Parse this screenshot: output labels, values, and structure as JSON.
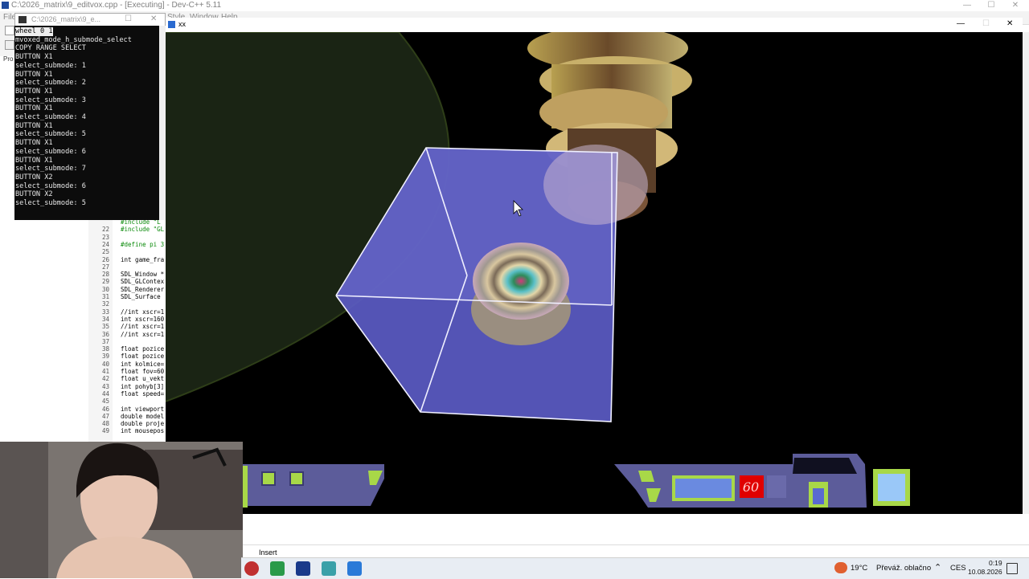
{
  "devcpp": {
    "window_title": "C:\\2026_matrix\\9_editvox.cpp - [Executing] - Dev-C++ 5.11",
    "menu": [
      "File",
      "Style",
      "Window",
      "Help"
    ],
    "sidebar_tab": "Pro",
    "editor_lines": [
      {
        "n": "",
        "t": "#include \"L",
        "c": "green"
      },
      {
        "n": "22",
        "t": "#include \"GL",
        "c": "green"
      },
      {
        "n": "23",
        "t": "",
        "c": ""
      },
      {
        "n": "24",
        "t": "#define pi 3",
        "c": "green"
      },
      {
        "n": "25",
        "t": "",
        "c": ""
      },
      {
        "n": "26",
        "t": "int game_fra",
        "c": ""
      },
      {
        "n": "27",
        "t": "",
        "c": ""
      },
      {
        "n": "28",
        "t": "SDL_Window *",
        "c": ""
      },
      {
        "n": "29",
        "t": "SDL_GLContex",
        "c": ""
      },
      {
        "n": "30",
        "t": "SDL_Renderer",
        "c": ""
      },
      {
        "n": "31",
        "t": "SDL_Surface",
        "c": ""
      },
      {
        "n": "32",
        "t": "",
        "c": ""
      },
      {
        "n": "33",
        "t": "//int xscr=1",
        "c": ""
      },
      {
        "n": "34",
        "t": "int xscr=160",
        "c": ""
      },
      {
        "n": "35",
        "t": "//int xscr=1",
        "c": ""
      },
      {
        "n": "36",
        "t": "//int xscr=1",
        "c": ""
      },
      {
        "n": "37",
        "t": "",
        "c": ""
      },
      {
        "n": "38",
        "t": "float pozice",
        "c": ""
      },
      {
        "n": "39",
        "t": "float pozice",
        "c": ""
      },
      {
        "n": "40",
        "t": "int kolmice=",
        "c": ""
      },
      {
        "n": "41",
        "t": "float fov=60",
        "c": ""
      },
      {
        "n": "42",
        "t": "float u_vekt",
        "c": ""
      },
      {
        "n": "43",
        "t": "int pohyb[3]",
        "c": ""
      },
      {
        "n": "44",
        "t": "float speed=",
        "c": ""
      },
      {
        "n": "45",
        "t": "",
        "c": ""
      },
      {
        "n": "46",
        "t": "int viewport",
        "c": ""
      },
      {
        "n": "47",
        "t": "double model",
        "c": ""
      },
      {
        "n": "48",
        "t": "double proje",
        "c": ""
      },
      {
        "n": "49",
        "t": "int mousepos",
        "c": ""
      }
    ],
    "status_mode": "Insert"
  },
  "console": {
    "title": "C:\\2026_matrix\\9_e...",
    "lines": [
      "wheel 0 1",
      "mvoxed_mode_h_submode_select",
      "COPY RANGE SELECT",
      "BUTTON X1",
      "select_submode: 1",
      "BUTTON X1",
      "select_submode: 2",
      "BUTTON X1",
      "select_submode: 3",
      "BUTTON X1",
      "select_submode: 4",
      "BUTTON X1",
      "select_submode: 5",
      "BUTTON X1",
      "select_submode: 6",
      "BUTTON X1",
      "select_submode: 7",
      "BUTTON X2",
      "select_submode: 6",
      "BUTTON X2",
      "select_submode: 5"
    ]
  },
  "sdl_window": {
    "title": "xx",
    "hud_fps": "60",
    "colors": {
      "cube_face": "#5b5bc4",
      "cube_edge": "#f0f0ff",
      "hud_body": "#5c5c9a",
      "hud_green": "#a8d848",
      "fps_bg": "#e00000"
    }
  },
  "taskbar": {
    "weather_temp": "19°C",
    "weather_text": "Převáž. oblačno",
    "language": "CES",
    "time": "0:19",
    "date": "10.08.2026"
  },
  "window_controls": {
    "minimize": "—",
    "maximize": "☐",
    "close": "✕"
  }
}
